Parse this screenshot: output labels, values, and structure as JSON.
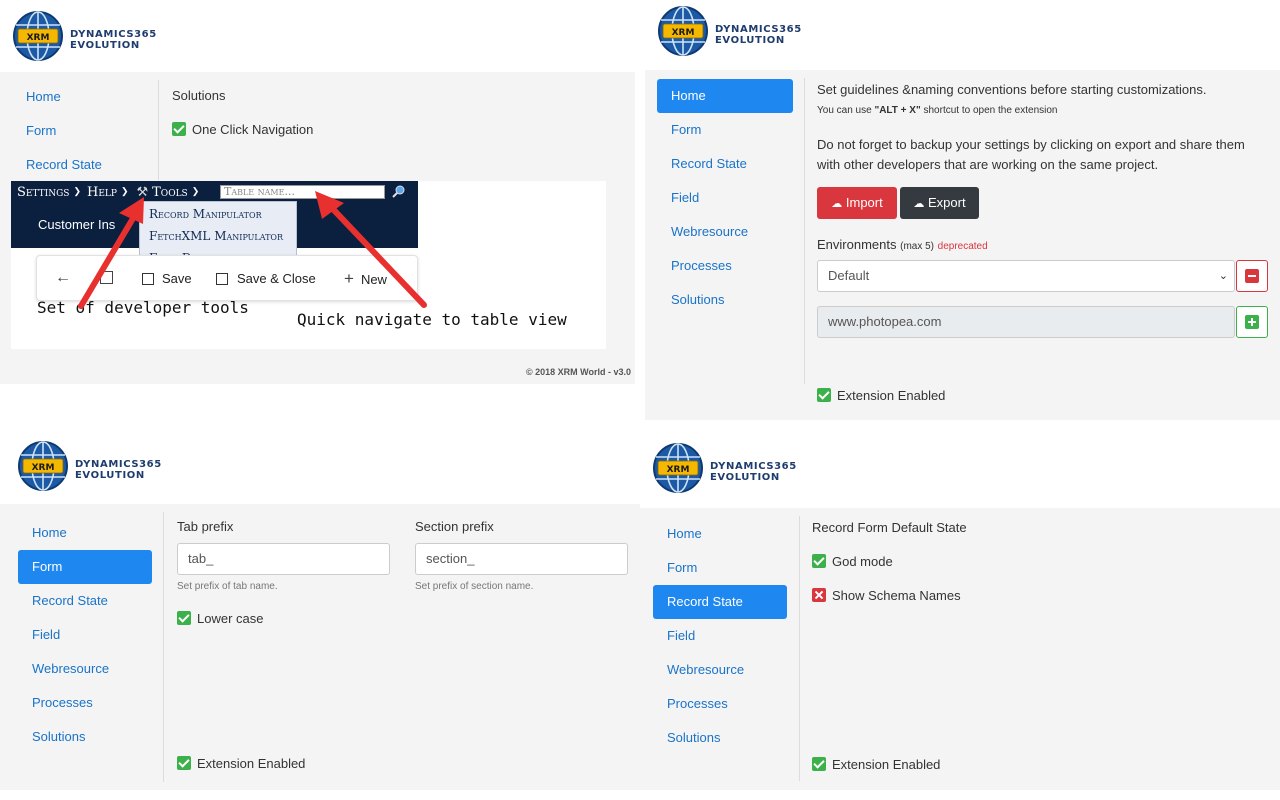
{
  "brand": {
    "line1": "DYNAMICS365",
    "line2": "EVOLUTION",
    "badge": "XRM"
  },
  "colors": {
    "accent": "#1e88f0",
    "link": "#1a73c9",
    "danger": "#d9363e",
    "success": "#3cb04a",
    "dark": "#343a40",
    "crm_nav": "#0b1f3f"
  },
  "panel1": {
    "nav": [
      "Home",
      "Form",
      "Record State"
    ],
    "title": "Solutions",
    "checkbox": "One Click Navigation",
    "crm_bar": {
      "settings": "Settings",
      "help": "Help",
      "tools": "Tools",
      "search_placeholder": "Table name..."
    },
    "tools_menu": [
      "Record Manipulator",
      "FetchXML Manipulator",
      "Form Documentation"
    ],
    "entity": "Customer Ins",
    "toolbar": {
      "save": "Save",
      "save_close": "Save & Close",
      "new": "New"
    },
    "annotation1": "Set of developer tools",
    "annotation2": "Quick navigate to table view",
    "footer": "© 2018 XRM World - v3.0"
  },
  "panel2": {
    "nav": [
      "Home",
      "Form",
      "Record State",
      "Field",
      "Webresource",
      "Processes",
      "Solutions"
    ],
    "active": "Home",
    "guideline": "Set guidelines &naming conventions before starting customizations.",
    "shortcut_pre": "You can use ",
    "shortcut_key": "\"ALT + X\"",
    "shortcut_post": " shortcut to open the extension",
    "backup": "Do not forget to backup your settings by clicking on export and share them with other developers that are working on the same project.",
    "import": "Import",
    "export": "Export",
    "env_label": "Environments",
    "env_max": "(max 5)",
    "env_deprecated": "deprecated",
    "env_selected": "Default",
    "env_url": "www.photopea.com",
    "enabled": "Extension Enabled"
  },
  "panel3": {
    "nav": [
      "Home",
      "Form",
      "Record State",
      "Field",
      "Webresource",
      "Processes",
      "Solutions"
    ],
    "active": "Form",
    "tab_label": "Tab prefix",
    "tab_value": "tab_",
    "tab_hint": "Set prefix of tab name.",
    "section_label": "Section prefix",
    "section_value": "section_",
    "section_hint": "Set prefix of section name.",
    "lower": "Lower case",
    "enabled": "Extension Enabled"
  },
  "panel4": {
    "nav": [
      "Home",
      "Form",
      "Record State",
      "Field",
      "Webresource",
      "Processes",
      "Solutions"
    ],
    "active": "Record State",
    "title": "Record Form Default State",
    "god": "God mode",
    "schema": "Show Schema Names",
    "enabled": "Extension Enabled"
  }
}
